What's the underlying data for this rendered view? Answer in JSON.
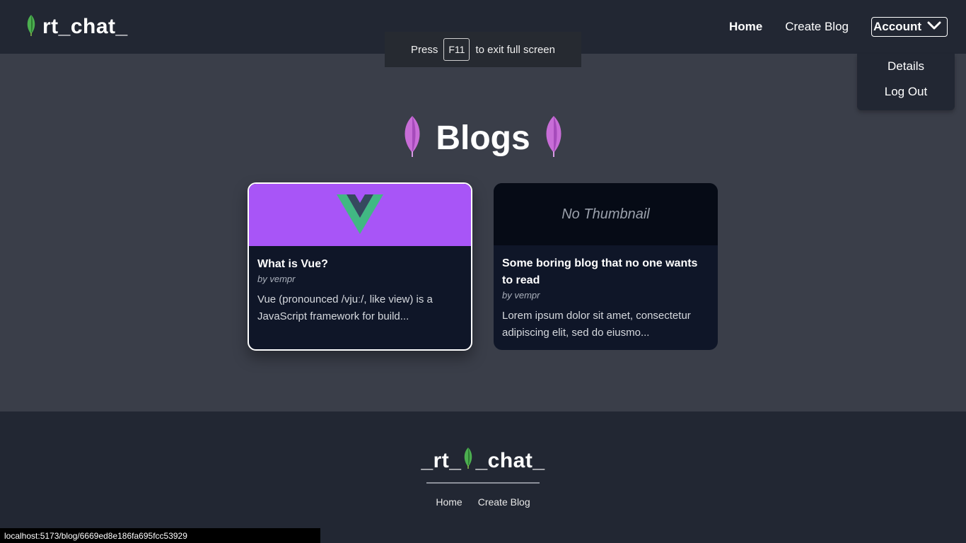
{
  "header": {
    "brand": "rt_chat_",
    "nav": {
      "home": "Home",
      "create_blog": "Create Blog",
      "account": "Account"
    }
  },
  "account_menu": {
    "items": [
      "Details",
      "Log Out"
    ]
  },
  "fullscreen_notice": {
    "press": "Press",
    "key": "F11",
    "rest": "to exit full screen"
  },
  "page": {
    "title": "Blogs"
  },
  "blogs": [
    {
      "title": "What is Vue?",
      "author": "by vempr",
      "excerpt": "Vue (pronounced /vjuː/, like view) is a JavaScript framework for build...",
      "thumbnail": "vue-logo-icon"
    },
    {
      "title": "Some boring blog that no one wants to read",
      "author": "by vempr",
      "excerpt": "Lorem ipsum dolor sit amet, consectetur adipiscing elit, sed do eiusmo...",
      "thumbnail_text": "No Thumbnail"
    }
  ],
  "footer": {
    "brand_left": "_rt_",
    "brand_right": "_chat_",
    "nav": [
      "Home",
      "Create Blog"
    ]
  },
  "status_bar": {
    "url": "localhost:5173/blog/6669ed8e186fa695fcc53929"
  },
  "colors": {
    "page_bg": "#3a3e49",
    "header_bg": "#222733",
    "card_bg": "#0f1628",
    "thumb_purple": "#a855f7",
    "leaf_green": "#4caf50",
    "leaf_purple": "#c86dd7"
  }
}
